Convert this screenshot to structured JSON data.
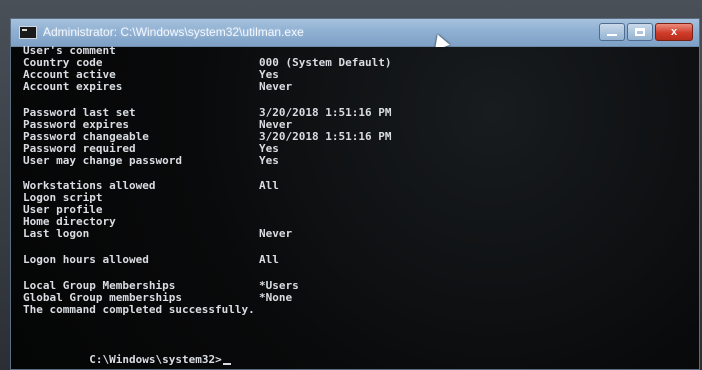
{
  "window": {
    "title": "Administrator: C:\\Windows\\system32\\utilman.exe",
    "icon": "console-icon",
    "controls": {
      "minimize": "minimize-icon",
      "maximize": "maximize-icon",
      "close_label": "x"
    }
  },
  "console": {
    "rows": [
      {
        "label": "User's comment",
        "value": ""
      },
      {
        "label": "Country code",
        "value": "000 (System Default)"
      },
      {
        "label": "Account active",
        "value": "Yes"
      },
      {
        "label": "Account expires",
        "value": "Never"
      },
      {
        "label": "Password last set",
        "value": "3/20/2018 1:51:16 PM"
      },
      {
        "label": "Password expires",
        "value": "Never"
      },
      {
        "label": "Password changeable",
        "value": "3/20/2018 1:51:16 PM"
      },
      {
        "label": "Password required",
        "value": "Yes"
      },
      {
        "label": "User may change password",
        "value": "Yes"
      },
      {
        "label": "Workstations allowed",
        "value": "All"
      },
      {
        "label": "Logon script",
        "value": ""
      },
      {
        "label": "User profile",
        "value": ""
      },
      {
        "label": "Home directory",
        "value": ""
      },
      {
        "label": "Last logon",
        "value": "Never"
      },
      {
        "label": "Logon hours allowed",
        "value": "All"
      },
      {
        "label": "Local Group Memberships",
        "value": "*Users"
      },
      {
        "label": "Global Group memberships",
        "value": "*None"
      }
    ],
    "completion_message": "The command completed successfully.",
    "prompt": "C:\\Windows\\system32>"
  },
  "colors": {
    "console_text": "#d9dde2",
    "console_bg": "#090a0b",
    "titlebar": "#8fb0d2",
    "close_button": "#cf3d2a"
  }
}
